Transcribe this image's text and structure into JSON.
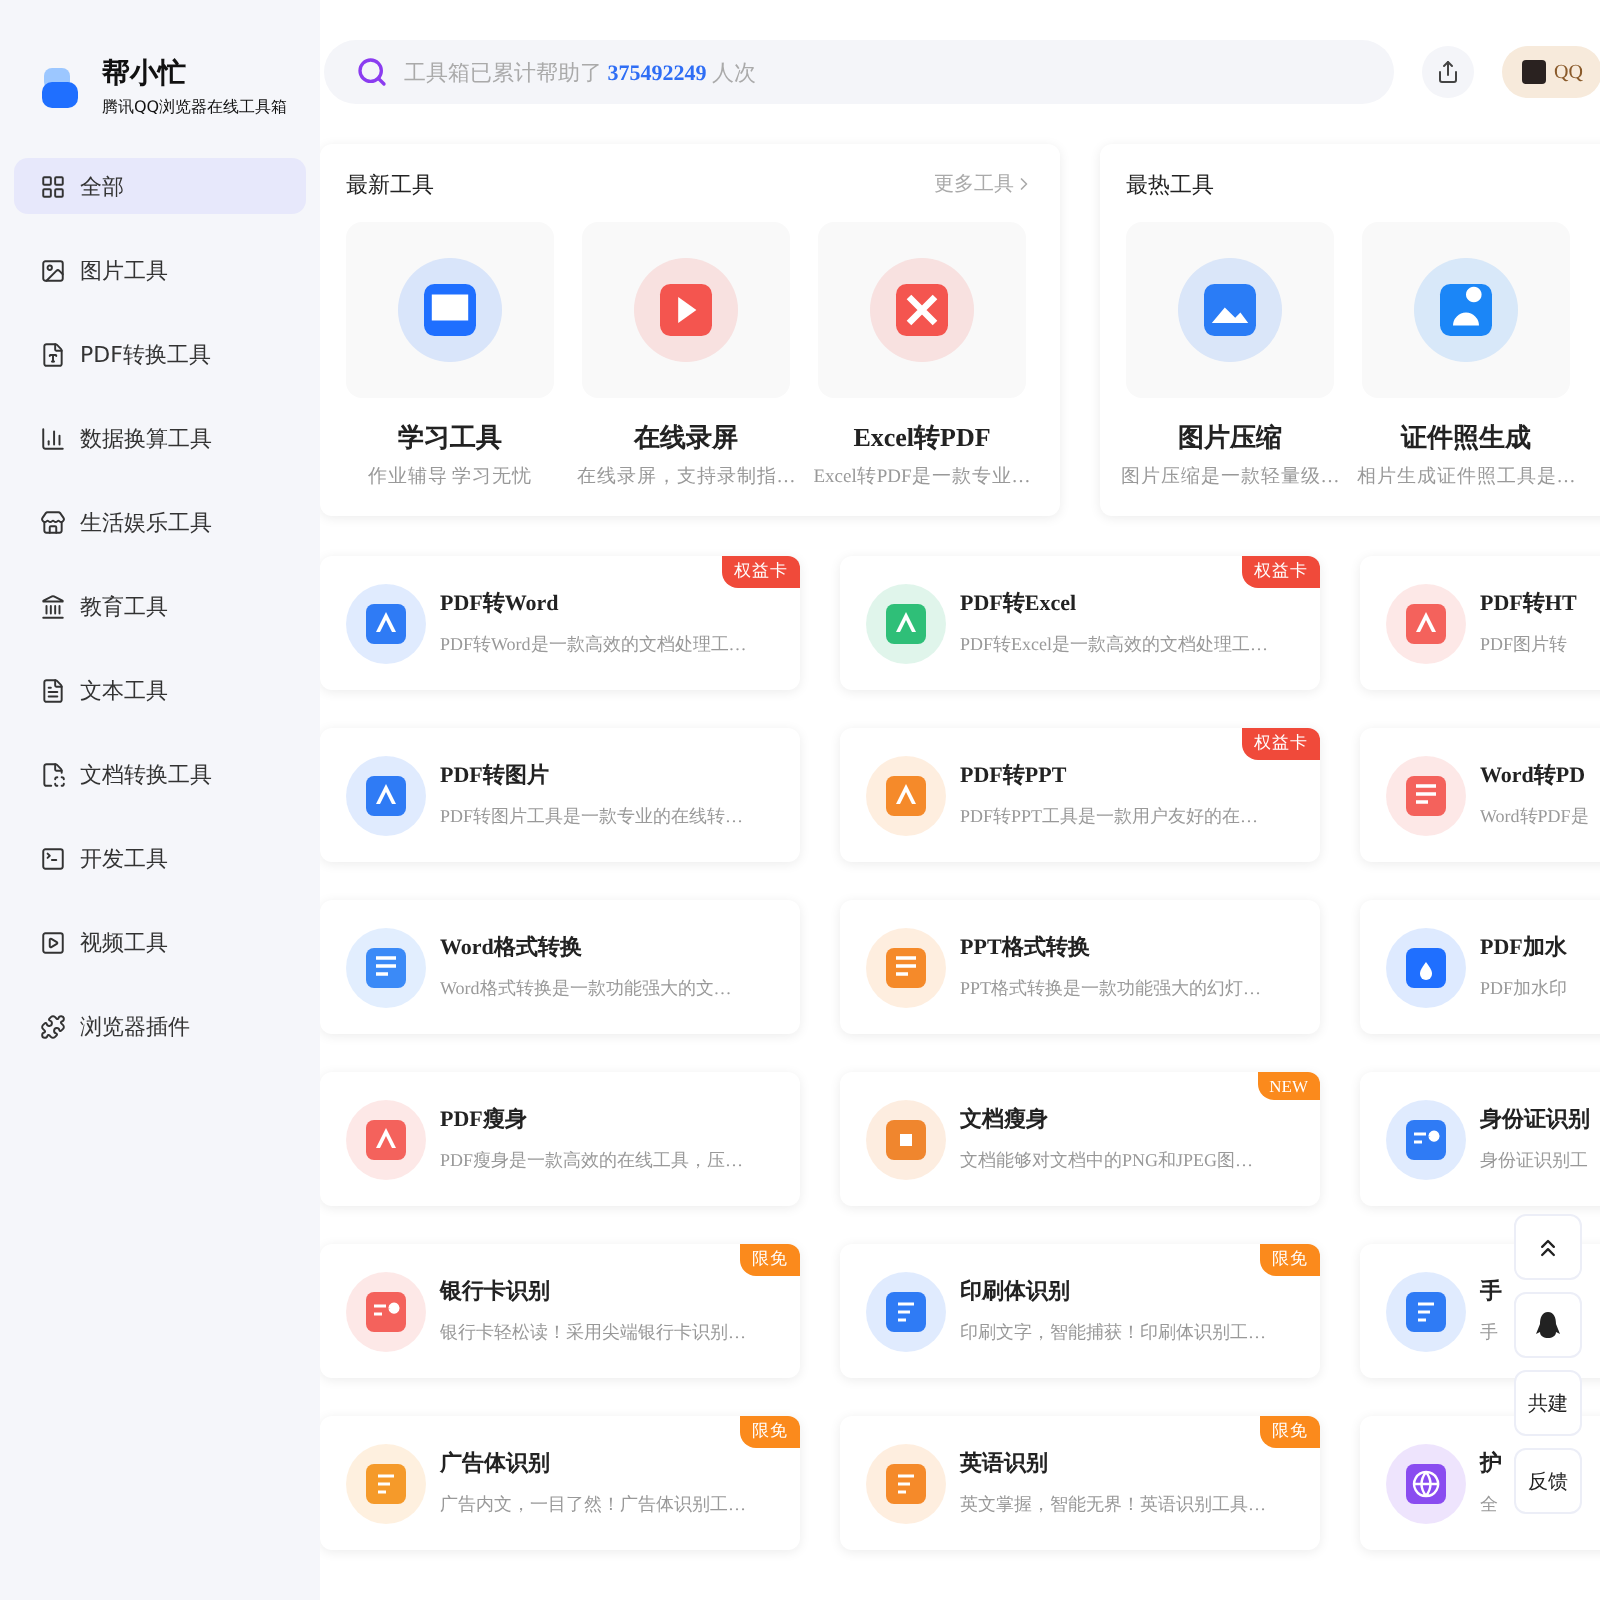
{
  "brand": {
    "name": "帮小忙",
    "tagline": "腾讯QQ浏览器在线工具箱"
  },
  "sidebar": {
    "items": [
      {
        "label": "全部",
        "selected": true
      },
      {
        "label": "图片工具",
        "selected": false
      },
      {
        "label": "PDF转换工具",
        "selected": false
      },
      {
        "label": "数据换算工具",
        "selected": false
      },
      {
        "label": "生活娱乐工具",
        "selected": false
      },
      {
        "label": "教育工具",
        "selected": false
      },
      {
        "label": "文本工具",
        "selected": false
      },
      {
        "label": "文档转换工具",
        "selected": false
      },
      {
        "label": "开发工具",
        "selected": false
      },
      {
        "label": "视频工具",
        "selected": false
      },
      {
        "label": "浏览器插件",
        "selected": false
      }
    ]
  },
  "search": {
    "prefix": "工具箱已累计帮助了",
    "count": "375492249",
    "suffix": "人次"
  },
  "header": {
    "vip_label": "QQ"
  },
  "newest": {
    "title": "最新工具",
    "more": "更多工具",
    "items": [
      {
        "name": "学习工具",
        "desc": "作业辅导 学习无忧",
        "color": "#1f6fff"
      },
      {
        "name": "在线录屏",
        "desc": "在线录屏，支持录制指…",
        "color": "#f4554f"
      },
      {
        "name": "Excel转PDF",
        "desc": "Excel转PDF是一款专业…",
        "color": "#f4554f"
      }
    ]
  },
  "hottest": {
    "title": "最热工具",
    "items": [
      {
        "name": "图片压缩",
        "desc": "图片压缩是一款轻量级…",
        "color": "#2a7cf6"
      },
      {
        "name": "证件照生成",
        "desc": "相片生成证件照工具是…",
        "color": "#1b86f7"
      }
    ]
  },
  "tools": [
    {
      "name": "PDF转Word",
      "desc": "PDF转Word是一款高效的文档处理工…",
      "color": "#2f7bf5",
      "badge": {
        "text": "权益卡",
        "kind": "rights"
      }
    },
    {
      "name": "PDF转Excel",
      "desc": "PDF转Excel是一款高效的文档处理工…",
      "color": "#2fbf78",
      "badge": {
        "text": "权益卡",
        "kind": "rights"
      }
    },
    {
      "name": "PDF转HT",
      "desc": "PDF图片转",
      "color": "#f4625c"
    },
    {
      "name": "PDF转图片",
      "desc": "PDF转图片工具是一款专业的在线转…",
      "color": "#2f7bf5"
    },
    {
      "name": "PDF转PPT",
      "desc": "PDF转PPT工具是一款用户友好的在…",
      "color": "#f58a2a",
      "badge": {
        "text": "权益卡",
        "kind": "rights"
      }
    },
    {
      "name": "Word转PD",
      "desc": "Word转PDF是",
      "color": "#f4625c"
    },
    {
      "name": "Word格式转换",
      "desc": "Word格式转换是一款功能强大的文…",
      "color": "#3b8af7"
    },
    {
      "name": "PPT格式转换",
      "desc": "PPT格式转换是一款功能强大的幻灯…",
      "color": "#f58a2a"
    },
    {
      "name": "PDF加水",
      "desc": "PDF加水印",
      "color": "#1f6fff"
    },
    {
      "name": "PDF瘦身",
      "desc": "PDF瘦身是一款高效的在线工具，压…",
      "color": "#f4625c"
    },
    {
      "name": "文档瘦身",
      "desc": "文档能够对文档中的PNG和JPEG图…",
      "color": "#f0862e",
      "badge": {
        "text": "NEW",
        "kind": "new"
      }
    },
    {
      "name": "身份证识别",
      "desc": "身份证识别工",
      "color": "#2f7bf5"
    },
    {
      "name": "银行卡识别",
      "desc": "银行卡轻松读！采用尖端银行卡识别…",
      "color": "#f4625c",
      "badge": {
        "text": "限免",
        "kind": "free"
      }
    },
    {
      "name": "印刷体识别",
      "desc": "印刷文字，智能捕获！印刷体识别工…",
      "color": "#2f7bf5",
      "badge": {
        "text": "限免",
        "kind": "free"
      }
    },
    {
      "name": "手",
      "desc": "手",
      "color": "#2f7bf5"
    },
    {
      "name": "广告体识别",
      "desc": "广告内文，一目了然！广告体识别工…",
      "color": "#f59a2a",
      "badge": {
        "text": "限免",
        "kind": "free"
      }
    },
    {
      "name": "英语识别",
      "desc": "英文掌握，智能无界！英语识别工具…",
      "color": "#f58a2a",
      "badge": {
        "text": "限免",
        "kind": "free"
      }
    },
    {
      "name": "护",
      "desc": "全",
      "color": "#8a4cf0"
    }
  ],
  "float_buttons": [
    {
      "kind": "top"
    },
    {
      "kind": "qq"
    },
    {
      "kind": "text",
      "label": "共建"
    },
    {
      "kind": "text",
      "label": "反馈"
    }
  ]
}
